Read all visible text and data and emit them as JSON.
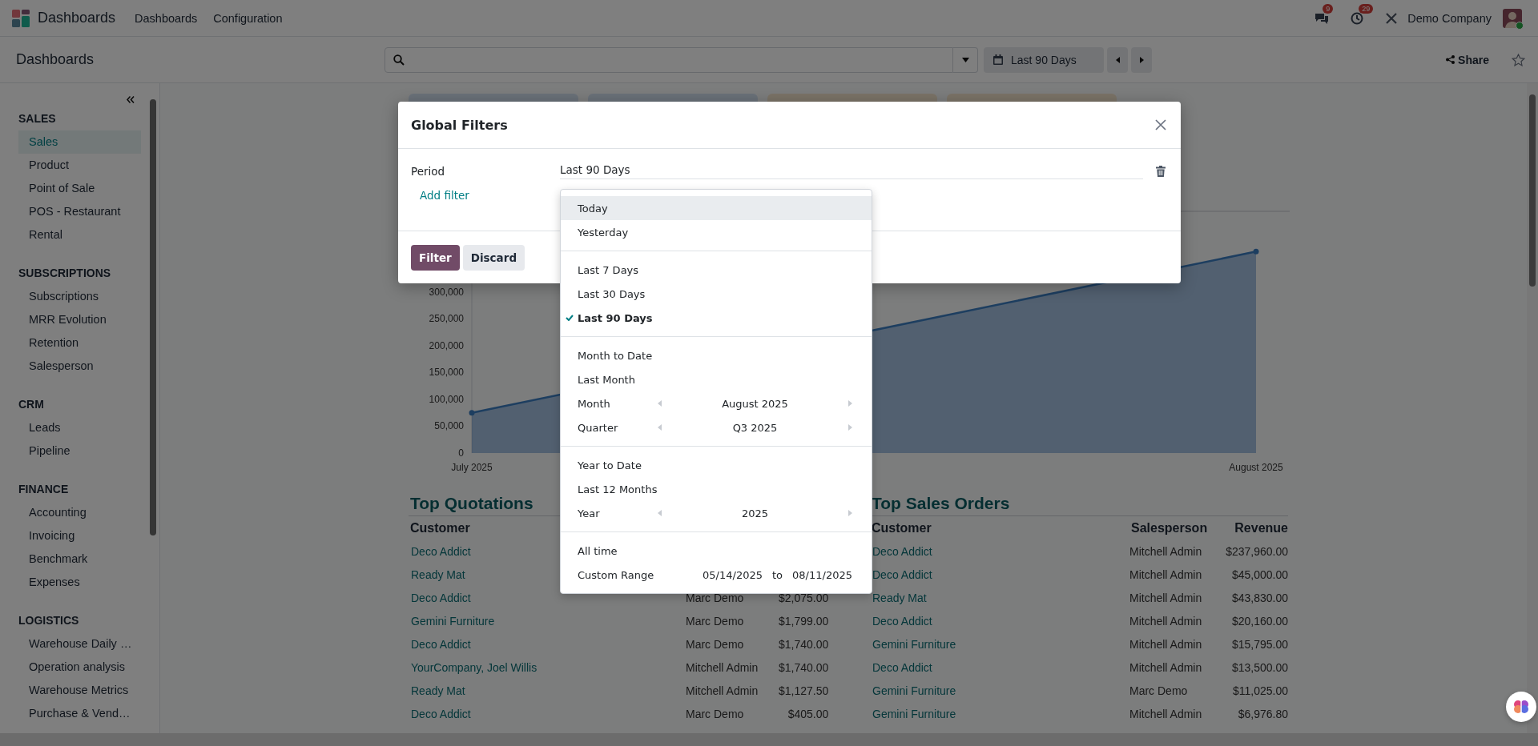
{
  "navbar": {
    "app_name": "Dashboards",
    "menus": [
      "Dashboards",
      "Configuration"
    ],
    "chat_badge": "9",
    "activity_badge": "29",
    "company": "Demo Company"
  },
  "control_panel": {
    "title": "Dashboards",
    "date_filter": "Last 90 Days",
    "share": "Share"
  },
  "sidebar": {
    "sections": [
      {
        "title": "SALES",
        "items": [
          {
            "label": "Sales",
            "selected": true
          },
          {
            "label": "Product",
            "selected": false
          },
          {
            "label": "Point of Sale",
            "selected": false
          },
          {
            "label": "POS - Restaurant",
            "selected": false
          },
          {
            "label": "Rental",
            "selected": false
          }
        ]
      },
      {
        "title": "SUBSCRIPTIONS",
        "items": [
          {
            "label": "Subscriptions",
            "selected": false
          },
          {
            "label": "MRR Evolution",
            "selected": false
          },
          {
            "label": "Retention",
            "selected": false
          },
          {
            "label": "Salesperson",
            "selected": false
          }
        ]
      },
      {
        "title": "CRM",
        "items": [
          {
            "label": "Leads",
            "selected": false
          },
          {
            "label": "Pipeline",
            "selected": false
          }
        ]
      },
      {
        "title": "FINANCE",
        "items": [
          {
            "label": "Accounting",
            "selected": false
          },
          {
            "label": "Invoicing",
            "selected": false
          },
          {
            "label": "Benchmark",
            "selected": false
          },
          {
            "label": "Expenses",
            "selected": false
          }
        ]
      },
      {
        "title": "LOGISTICS",
        "items": [
          {
            "label": "Warehouse Daily …",
            "selected": false
          },
          {
            "label": "Operation analysis",
            "selected": false
          },
          {
            "label": "Warehouse Metrics",
            "selected": false
          },
          {
            "label": "Purchase & Vend…",
            "selected": false
          }
        ]
      }
    ]
  },
  "chart": {
    "chart_data": {
      "type": "area",
      "x": [
        "July 2025",
        "August 2025"
      ],
      "series": [
        {
          "color": "#3b7dc0",
          "values": [
            75000,
            375000
          ]
        }
      ],
      "ylim": [
        0,
        450000
      ],
      "yticks": [
        0,
        {
          "value": 50000,
          "label": "50,000"
        },
        {
          "value": 100000,
          "label": "100,000"
        },
        {
          "value": 150000,
          "label": "150,000"
        },
        {
          "value": 200000,
          "label": "200,000"
        },
        {
          "value": 250000,
          "label": "250,000"
        },
        {
          "value": 300000,
          "label": "300,000"
        }
      ]
    }
  },
  "quotations": {
    "title": "Top Quotations",
    "columns": [
      "Customer"
    ],
    "rows": [
      {
        "customer": "Deco Addict"
      },
      {
        "customer": "Ready Mat"
      },
      {
        "customer": "Deco Addict",
        "salesperson": "Marc Demo",
        "revenue": "$2,075.00"
      },
      {
        "customer": "Gemini Furniture",
        "salesperson": "Marc Demo",
        "revenue": "$1,799.00"
      },
      {
        "customer": "Deco Addict",
        "salesperson": "Marc Demo",
        "revenue": "$1,740.00"
      },
      {
        "customer": "YourCompany, Joel Willis",
        "salesperson": "Mitchell Admin",
        "revenue": "$1,740.00"
      },
      {
        "customer": "Ready Mat",
        "salesperson": "Mitchell Admin",
        "revenue": "$1,127.50"
      },
      {
        "customer": "Deco Addict",
        "salesperson": "Marc Demo",
        "revenue": "$405.00"
      }
    ]
  },
  "sales_orders": {
    "title": "Top Sales Orders",
    "columns": [
      "Customer",
      "Salesperson",
      "Revenue"
    ],
    "rows": [
      {
        "customer": "Deco Addict",
        "salesperson": "Mitchell Admin",
        "revenue": "$237,960.00"
      },
      {
        "customer": "Deco Addict",
        "salesperson": "Mitchell Admin",
        "revenue": "$45,000.00"
      },
      {
        "customer": "Ready Mat",
        "salesperson": "Mitchell Admin",
        "revenue": "$43,830.00"
      },
      {
        "customer": "Deco Addict",
        "salesperson": "Mitchell Admin",
        "revenue": "$20,160.00"
      },
      {
        "customer": "Gemini Furniture",
        "salesperson": "Mitchell Admin",
        "revenue": "$15,795.00"
      },
      {
        "customer": "Deco Addict",
        "salesperson": "Mitchell Admin",
        "revenue": "$13,500.00"
      },
      {
        "customer": "Gemini Furniture",
        "salesperson": "Marc Demo",
        "revenue": "$11,025.00"
      },
      {
        "customer": "Gemini Furniture",
        "salesperson": "Mitchell Admin",
        "revenue": "$6,976.80"
      }
    ]
  },
  "dialog": {
    "title": "Global Filters",
    "filter_label": "Period",
    "filter_value": "Last 90 Days",
    "add_filter": "Add filter",
    "buttons": [
      {
        "label": "Filter",
        "kind": "primary"
      },
      {
        "label": "Discard",
        "kind": "secondary"
      }
    ]
  },
  "period_menu": {
    "groups": [
      {
        "items": [
          {
            "kind": "option",
            "label": "Today",
            "selected": false,
            "highlighted": true
          },
          {
            "kind": "option",
            "label": "Yesterday",
            "selected": false,
            "highlighted": false
          }
        ]
      },
      {
        "items": [
          {
            "kind": "option",
            "label": "Last 7 Days",
            "selected": false,
            "highlighted": false
          },
          {
            "kind": "option",
            "label": "Last 30 Days",
            "selected": false,
            "highlighted": false
          },
          {
            "kind": "option",
            "label": "Last 90 Days",
            "selected": true,
            "highlighted": false
          }
        ]
      },
      {
        "items": [
          {
            "kind": "option",
            "label": "Month to Date",
            "selected": false,
            "highlighted": false
          },
          {
            "kind": "option",
            "label": "Last Month",
            "selected": false,
            "highlighted": false
          },
          {
            "kind": "stepper",
            "label": "Month",
            "value": "August 2025",
            "selected": false,
            "highlighted": false
          },
          {
            "kind": "stepper",
            "label": "Quarter",
            "value": "Q3 2025",
            "selected": false,
            "highlighted": false
          }
        ]
      },
      {
        "items": [
          {
            "kind": "option",
            "label": "Year to Date",
            "selected": false,
            "highlighted": false
          },
          {
            "kind": "option",
            "label": "Last 12 Months",
            "selected": false,
            "highlighted": false
          },
          {
            "kind": "stepper",
            "label": "Year",
            "value": "2025",
            "selected": false,
            "highlighted": false
          }
        ]
      },
      {
        "items": [
          {
            "kind": "option",
            "label": "All time",
            "selected": false,
            "highlighted": false
          },
          {
            "kind": "range",
            "label": "Custom Range",
            "from": "05/14/2025",
            "joiner": "to",
            "to": "08/11/2025",
            "selected": false,
            "highlighted": false
          }
        ]
      }
    ]
  }
}
